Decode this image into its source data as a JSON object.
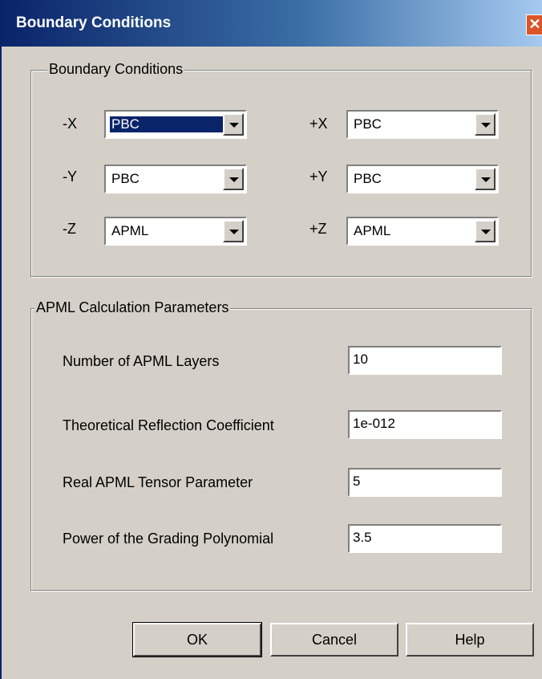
{
  "window": {
    "title": "Boundary Conditions",
    "close_glyph": "✕"
  },
  "boundary_group": {
    "title": "Boundary Conditions",
    "rows": [
      {
        "minus_label": "-X",
        "minus_value": "PBC",
        "plus_label": "+X",
        "plus_value": "PBC"
      },
      {
        "minus_label": "-Y",
        "minus_value": "PBC",
        "plus_label": "+Y",
        "plus_value": "PBC"
      },
      {
        "minus_label": "-Z",
        "minus_value": "APML",
        "plus_label": "+Z",
        "plus_value": "APML"
      }
    ]
  },
  "apml_group": {
    "title": "APML Calculation Parameters",
    "fields": [
      {
        "label": "Number of APML Layers",
        "value": "10"
      },
      {
        "label": "Theoretical Reflection Coefficient",
        "value": "1e-012"
      },
      {
        "label": "Real APML Tensor Parameter",
        "value": "5"
      },
      {
        "label": "Power of the Grading Polynomial",
        "value": "3.5"
      }
    ]
  },
  "buttons": {
    "ok": "OK",
    "cancel": "Cancel",
    "help": "Help"
  }
}
